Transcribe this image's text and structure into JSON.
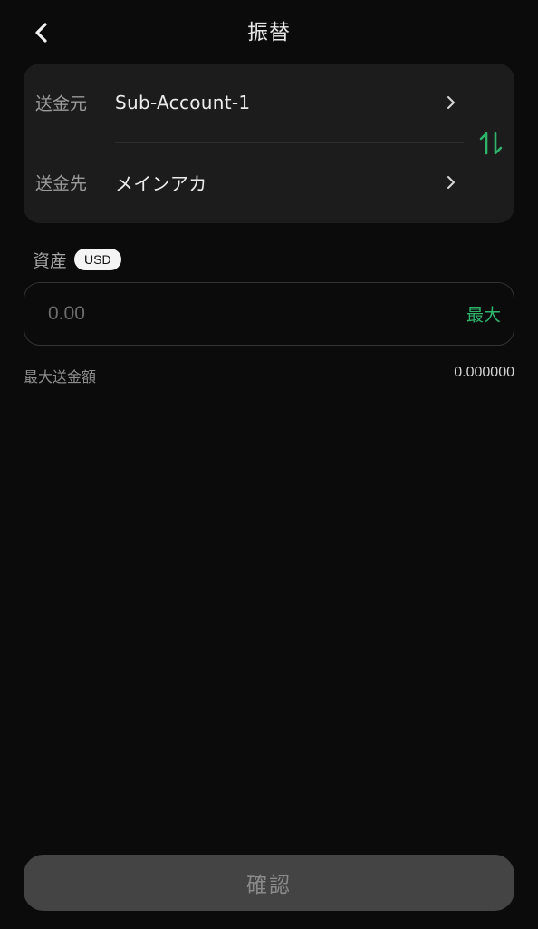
{
  "header": {
    "title": "振替",
    "back_icon": "chevron-left-icon"
  },
  "transfer": {
    "from_label": "送金元",
    "from_value": "Sub-Account-1",
    "to_label": "送金先",
    "to_value": "メインアカ",
    "swap_icon": "swap-vertical-icon",
    "accent_color": "#2fb36b"
  },
  "asset": {
    "label": "資産",
    "currency": "USD"
  },
  "amount": {
    "placeholder": "0.00",
    "max_label": "最大"
  },
  "max_transfer": {
    "label": "最大送金額",
    "value": "0.000000"
  },
  "confirm": {
    "label": "確認"
  }
}
